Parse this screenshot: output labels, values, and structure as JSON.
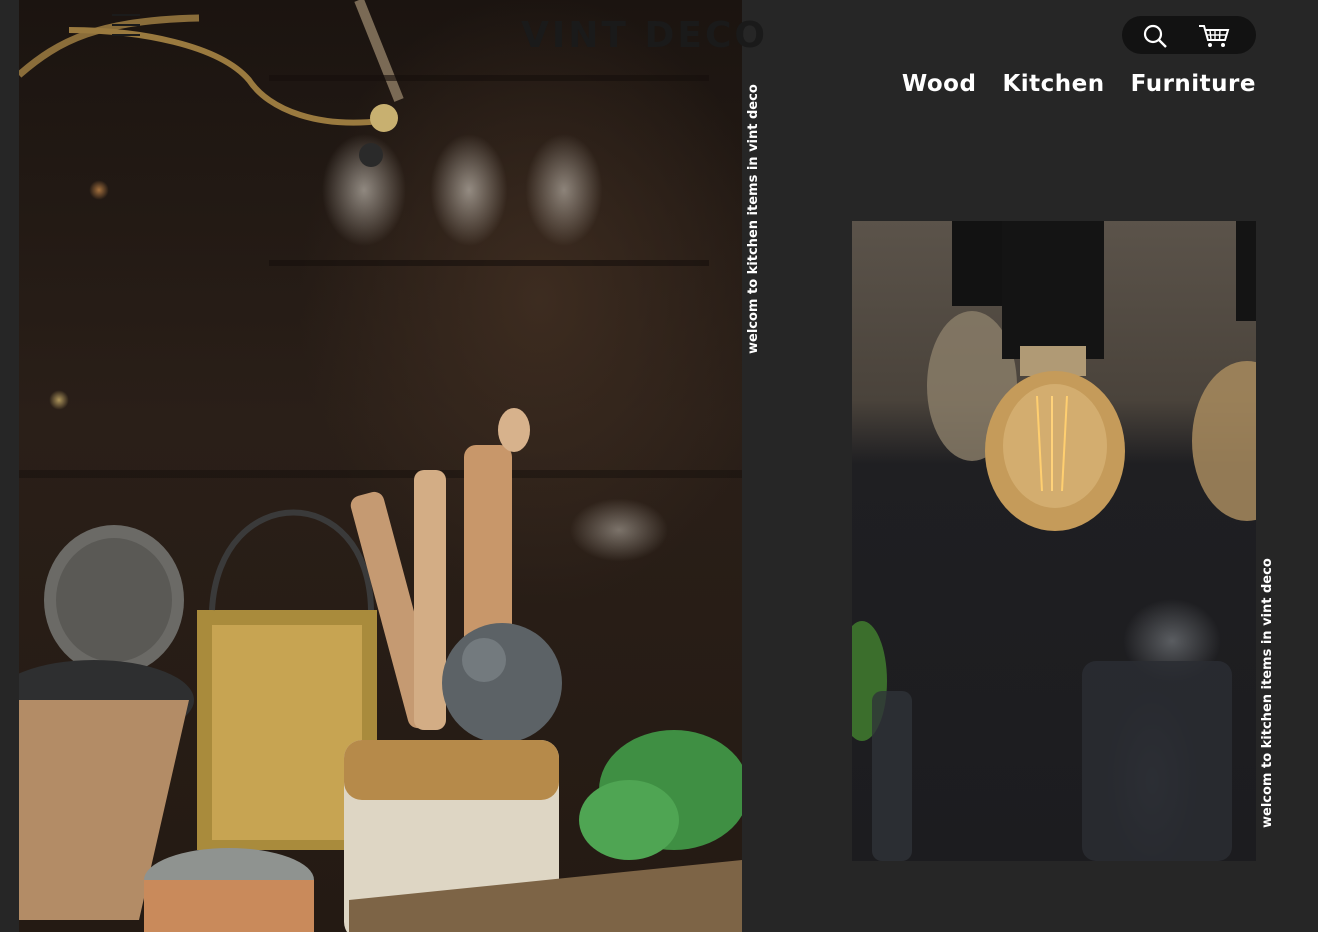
{
  "brand": {
    "logo_text": "VINT DECO"
  },
  "header": {
    "search_icon": "search-icon",
    "cart_icon": "shopping-cart-icon",
    "menu_icon": "hamburger-menu-icon"
  },
  "nav": {
    "items": [
      {
        "label": "Wood"
      },
      {
        "label": "Kitchen"
      },
      {
        "label": "Furniture"
      }
    ]
  },
  "taglines": {
    "top": "welcom to kitchen items in vint deco",
    "bottom": "welcom to kitchen items in vint deco"
  },
  "colors": {
    "background": "#262626",
    "text": "#ffffff",
    "logo": "#1a1a1a",
    "pill": "#121212"
  }
}
